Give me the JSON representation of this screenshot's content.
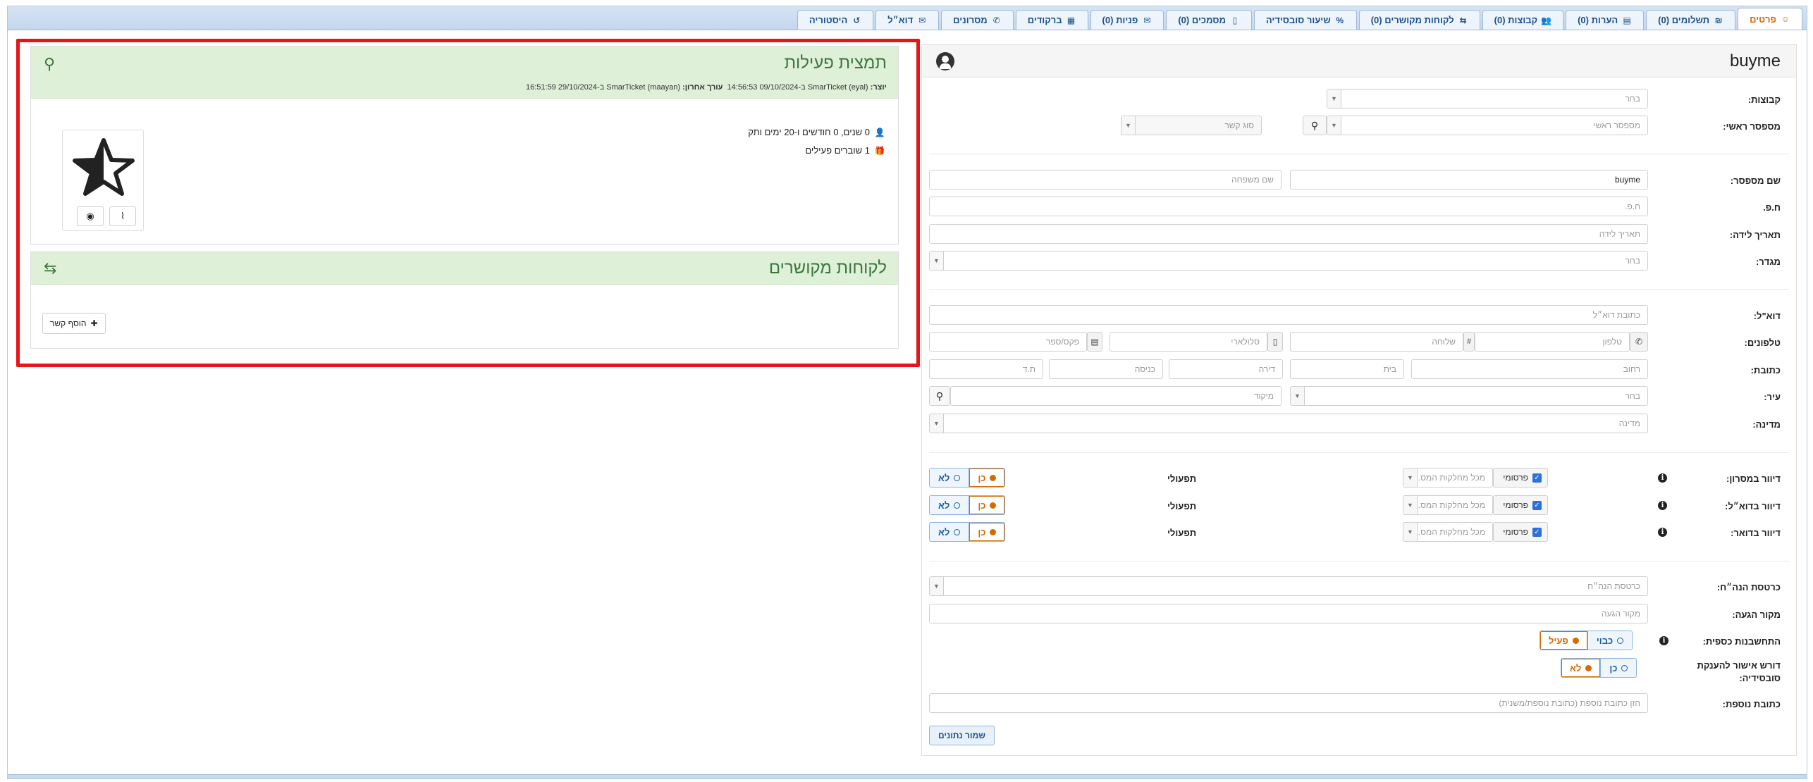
{
  "tabs": [
    {
      "id": "persons",
      "label": "פרטים",
      "icon": "user-circle-icon",
      "glyph": "☺",
      "active": true
    },
    {
      "id": "payments",
      "label": "תשלומים (0)",
      "icon": "money-icon",
      "glyph": "₪",
      "active": false
    },
    {
      "id": "notes",
      "label": "הערות (0)",
      "icon": "note-icon",
      "glyph": "▤",
      "active": false
    },
    {
      "id": "groups",
      "label": "קבוצות (0)",
      "icon": "users-icon",
      "glyph": "👥",
      "active": false
    },
    {
      "id": "linked",
      "label": "לקוחות מקושרים (0)",
      "icon": "people-link-icon",
      "glyph": "⇆",
      "active": false
    },
    {
      "id": "subsidy",
      "label": "שיעור סובסידיה",
      "icon": "percent-icon",
      "glyph": "%",
      "active": false
    },
    {
      "id": "docs",
      "label": "מסמכים (0)",
      "icon": "file-icon",
      "glyph": "▯",
      "active": false
    },
    {
      "id": "inquiries",
      "label": "פניות (0)",
      "icon": "chat-icon",
      "glyph": "✉",
      "active": false
    },
    {
      "id": "barcodes",
      "label": "ברקודים",
      "icon": "grid-icon",
      "glyph": "▦",
      "active": false
    },
    {
      "id": "sms",
      "label": "מסרונים",
      "icon": "sms-icon",
      "glyph": "✆",
      "active": false
    },
    {
      "id": "email",
      "label": "דוא״ל",
      "icon": "envelope-icon",
      "glyph": "✉",
      "active": false
    },
    {
      "id": "history",
      "label": "היסטוריה",
      "icon": "history-icon",
      "glyph": "↺",
      "active": false
    }
  ],
  "form": {
    "title": "buyme",
    "labels": {
      "groups": "קבוצות:",
      "main_client": "מספסר ראשי:",
      "client_name": "שם מספסר:",
      "id": "ח.פ.",
      "birth": "תאריך לידה:",
      "gender": "מגדר:",
      "email": "דוא\"ל:",
      "phones": "טלפונים:",
      "address": "כתובת:",
      "city": "עיר:",
      "country": "מדינה:",
      "mail_sms": "דיוור במסרון:",
      "mail_email": "דיוור בדוא״ל:",
      "mail_post": "דיוור בדואר:",
      "mgmt_card": "כרטסת הנה״ח:",
      "source": "מקור הגעה:",
      "accounting": "התחשבנות כספית:",
      "approval": "דורש אישור להענקת סובסידיה:",
      "extra_address": "כתובת נוספת:"
    },
    "values": {
      "groups": "בחר",
      "main_client": "מספסר ראשי",
      "link_type": "סוג קשר",
      "first_name": "buyme",
      "last_name": "שם משפחה",
      "id": "ח.פ.",
      "birth": "תאריך לידה",
      "gender": "בחר",
      "email": "כתובת דוא״ל",
      "phone": "טלפון",
      "ext": "שלוחה",
      "mobile": "סלולארי",
      "fax": "פקס/ספר",
      "street": "רחוב",
      "house": "בית",
      "apt": "דירה",
      "entrance": "כניסה",
      "pobox": "ת.ד",
      "city": "בחר",
      "zip": "מיקוד",
      "country": "מדינה",
      "mgmt_card": "כרטסת הנה״ח",
      "source": "מקור הגעה",
      "extra_address": "הזן כתובת נוספת (כתובת נוספת/משנית)"
    },
    "mailing": {
      "promo_label": "פרסומי",
      "channel_placeholder": "מכל מחלקות המס...",
      "operational_label": "תפעולי",
      "yes": "כן",
      "no": "לא"
    },
    "accounting": {
      "option_a": "כבוי",
      "option_b": "פעיל"
    },
    "approval": {
      "yes": "כן",
      "no": "לא"
    },
    "hash": "#",
    "save_label": "שמור נתונים"
  },
  "activity": {
    "title": "תמצית פעילות",
    "meta_created_label": "יוצר:",
    "meta_created": "SmarTicket (eyal) ב-09/10/2024 14:56:53",
    "meta_edited_label": "עורך אחרון:",
    "meta_edited": "SmarTicket (maayan) ב-29/10/2024 16:51:59",
    "seniority": "0 שנים, 0 חודשים ו-20 ימים ותק",
    "vouchers": "1 שוברים פעילים"
  },
  "linked": {
    "title": "לקוחות מקושרים",
    "add_label": "הוסף קשר"
  }
}
